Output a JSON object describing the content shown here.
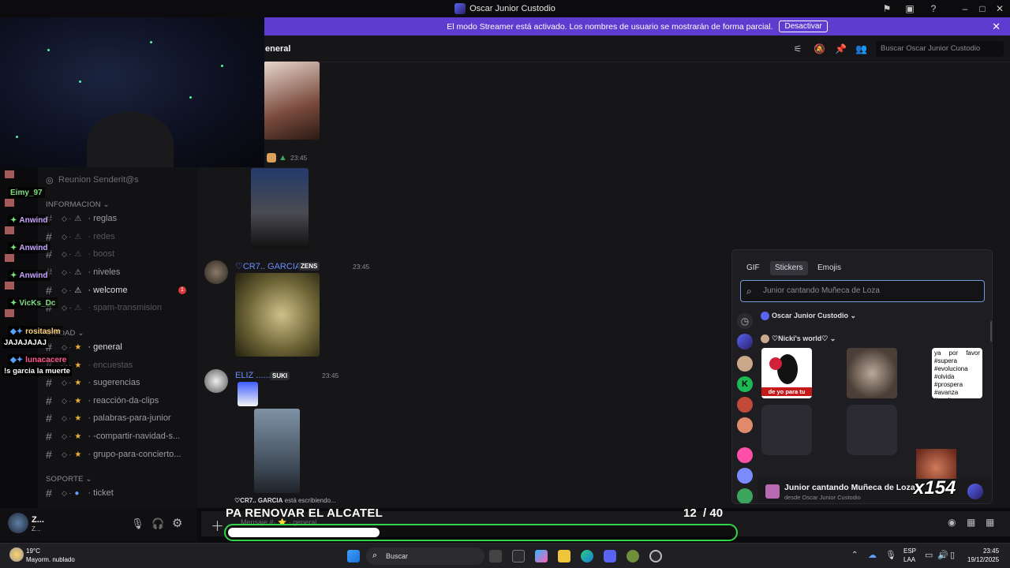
{
  "window": {
    "title": "Oscar Junior Custodio"
  },
  "banner": {
    "text": "El modo Streamer está activado. Los nombres de usuario se mostrarán de forma parcial.",
    "button": "Desactivar"
  },
  "header": {
    "channel": "eneral",
    "search_placeholder": "Buscar Oscar Junior Custodio"
  },
  "sidebar": {
    "event": "Reunion Senderit@s",
    "categories": {
      "info": "INFORMACION",
      "community": "UNIDAD",
      "support": "SOPORTE"
    },
    "channels": [
      {
        "name": "reglas"
      },
      {
        "name": "redes"
      },
      {
        "name": "boost"
      },
      {
        "name": "niveles"
      },
      {
        "name": "welcome",
        "badge": "1"
      },
      {
        "name": "spam-transmision"
      },
      {
        "name": "general"
      },
      {
        "name": "encuestas"
      },
      {
        "name": "sugerencias"
      },
      {
        "name": "reacción-da-clips"
      },
      {
        "name": "palabras-para-junior"
      },
      {
        "name": "-compartir-navidad-s..."
      },
      {
        "name": "grupo-para-concierto..."
      },
      {
        "name": "ticket"
      }
    ]
  },
  "overlay_chat": [
    {
      "name": "Eimy_97",
      "color": "#7ee07e"
    },
    {
      "name": "Anwind",
      "color": "#c9a5ff"
    },
    {
      "name": "Anwind",
      "color": "#c9a5ff"
    },
    {
      "name": "Anwind",
      "color": "#c9a5ff"
    },
    {
      "name": "VicKs_Dc",
      "color": "#7ee07e"
    },
    {
      "name": "rositaslm",
      "color": "#ffd27a",
      "message": "JAJAJAJAJ"
    },
    {
      "name": "lunacacere",
      "color": "#ff5a8a",
      "message": "!s garcia la muerte"
    }
  ],
  "user": {
    "name": "Z...",
    "status": "Z..."
  },
  "messages": [
    {
      "time": "23:45"
    },
    {
      "user": "♡CR7.. GARCIA",
      "tag": "ZENS",
      "time": "23:45"
    },
    {
      "user": "ELIZ .......",
      "tag": "SUKI",
      "time": "23:45"
    }
  ],
  "typing": {
    "user": "♡CR7.. GARCIA",
    "text": "está escribiendo..."
  },
  "composer": {
    "placeholder": "Mensaje #· ⭐ · general"
  },
  "picker": {
    "tabs": [
      "GIF",
      "Stickers",
      "Emojis"
    ],
    "active_tab": "Stickers",
    "search_value": "Junior cantando Muñeca de Loza",
    "packs": [
      "Oscar Junior Custodio",
      "♡Nicki's world♡"
    ],
    "sticker_text_1": "de yo para tu",
    "sticker_text_3": "ya por favor #supera #evoluciona #olvida #prospera #avanza #suelta",
    "footer_title": "Junior cantando Muñeca de Loza",
    "footer_sub": "desde Oscar Junior Custodio",
    "count_badge": "x154"
  },
  "overlay_goal": {
    "text": "PA RENOVAR EL ALCATEL",
    "current": "12",
    "separator": "/",
    "target": "40",
    "progress": 0.3
  },
  "taskbar": {
    "weather_temp": "19°C",
    "weather_desc": "Mayorm. nublado",
    "search": "Buscar",
    "lang_1": "ESP",
    "lang_2": "LAA",
    "time": "23:45",
    "date": "19/12/2025"
  },
  "colors": {
    "accent": "#5e3cd0",
    "progress_border": "#33d44b"
  }
}
